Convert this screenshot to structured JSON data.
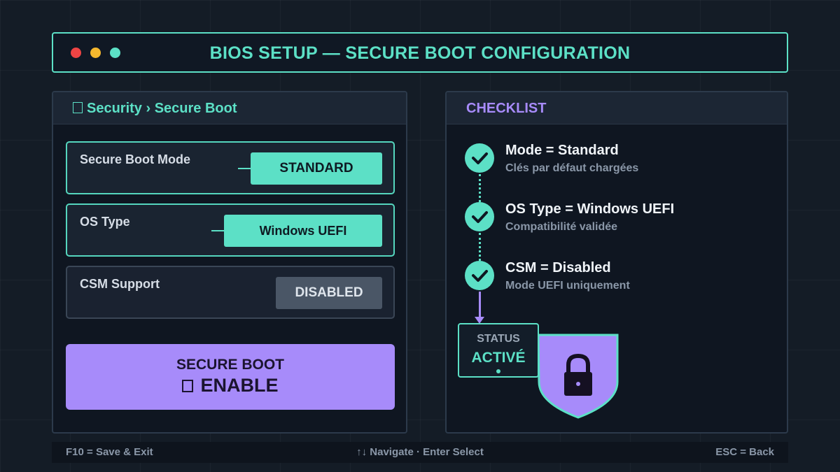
{
  "window": {
    "title": "BIOS SETUP — SECURE BOOT CONFIGURATION",
    "controls": [
      {
        "name": "close",
        "color": "#ef4444"
      },
      {
        "name": "minimize",
        "color": "#f5b82e"
      },
      {
        "name": "maximize",
        "color": "#5ce0c6"
      }
    ]
  },
  "settings_panel": {
    "breadcrumb": "Security › Secure Boot",
    "breadcrumb_icon": "shield-icon",
    "rows": [
      {
        "label": "Secure Boot Mode",
        "value": "STANDARD"
      },
      {
        "label": "OS Type",
        "value": "Windows UEFI"
      },
      {
        "label": "CSM Support",
        "value": "DISABLED"
      }
    ],
    "enable_button": {
      "line1": "SECURE BOOT",
      "line2": "ENABLE",
      "icon": "power-icon"
    }
  },
  "checklist_panel": {
    "title": "CHECKLIST",
    "items": [
      {
        "title": "Mode = Standard",
        "subtitle": "Clés par défaut chargées"
      },
      {
        "title": "OS Type = Windows UEFI",
        "subtitle": "Compatibilité validée"
      },
      {
        "title": "CSM = Disabled",
        "subtitle": "Mode UEFI uniquement"
      }
    ],
    "status": {
      "label": "STATUS",
      "value": "ACTIVÉ"
    },
    "shield_icon": "lock-shield-icon"
  },
  "footer": {
    "left": "F10 = Save & Exit",
    "center": "↑↓ Navigate · Enter Select",
    "right": "ESC = Back"
  },
  "colors": {
    "accent_teal": "#5ce0c6",
    "accent_purple": "#a78bfa",
    "background": "#141c26"
  }
}
